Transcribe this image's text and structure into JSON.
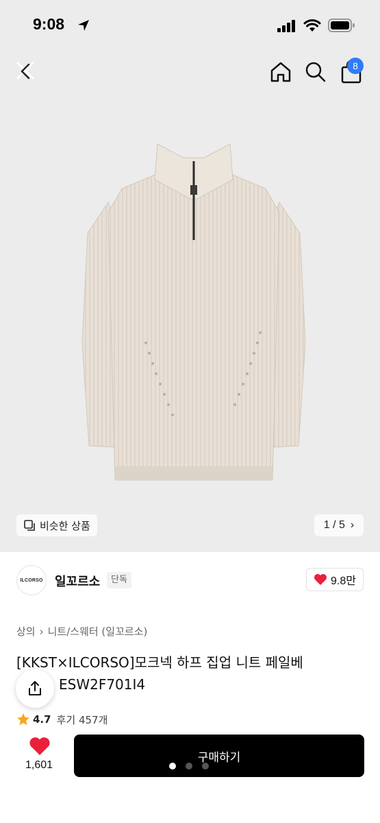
{
  "status_bar": {
    "time": "9:08"
  },
  "header": {
    "cart_count": "8"
  },
  "gallery": {
    "similar_label": "비슷한 상품",
    "pager": "1 / 5",
    "pager_chevron": "›"
  },
  "brand": {
    "logo_text": "ILCORSO",
    "name": "일꼬르소",
    "tag": "단독",
    "likes": "9.8만"
  },
  "breadcrumb": {
    "items": [
      "상의",
      "니트/스웨터 (일꼬르소)"
    ],
    "separator": "›"
  },
  "product": {
    "title_line1": "[KKST×ILCORSO]모크넥 하프 집업 니트 페일베",
    "title_line2": "ESW2F701I4",
    "rating": "4.7",
    "reviews": "후기 457개"
  },
  "bottom": {
    "like_count": "1,601",
    "buy_label": "구매하기"
  },
  "colors": {
    "accent_badge": "#2f7cf6",
    "heart": "#e8203a",
    "buy_button": "#000000",
    "star": "#f5a623"
  }
}
